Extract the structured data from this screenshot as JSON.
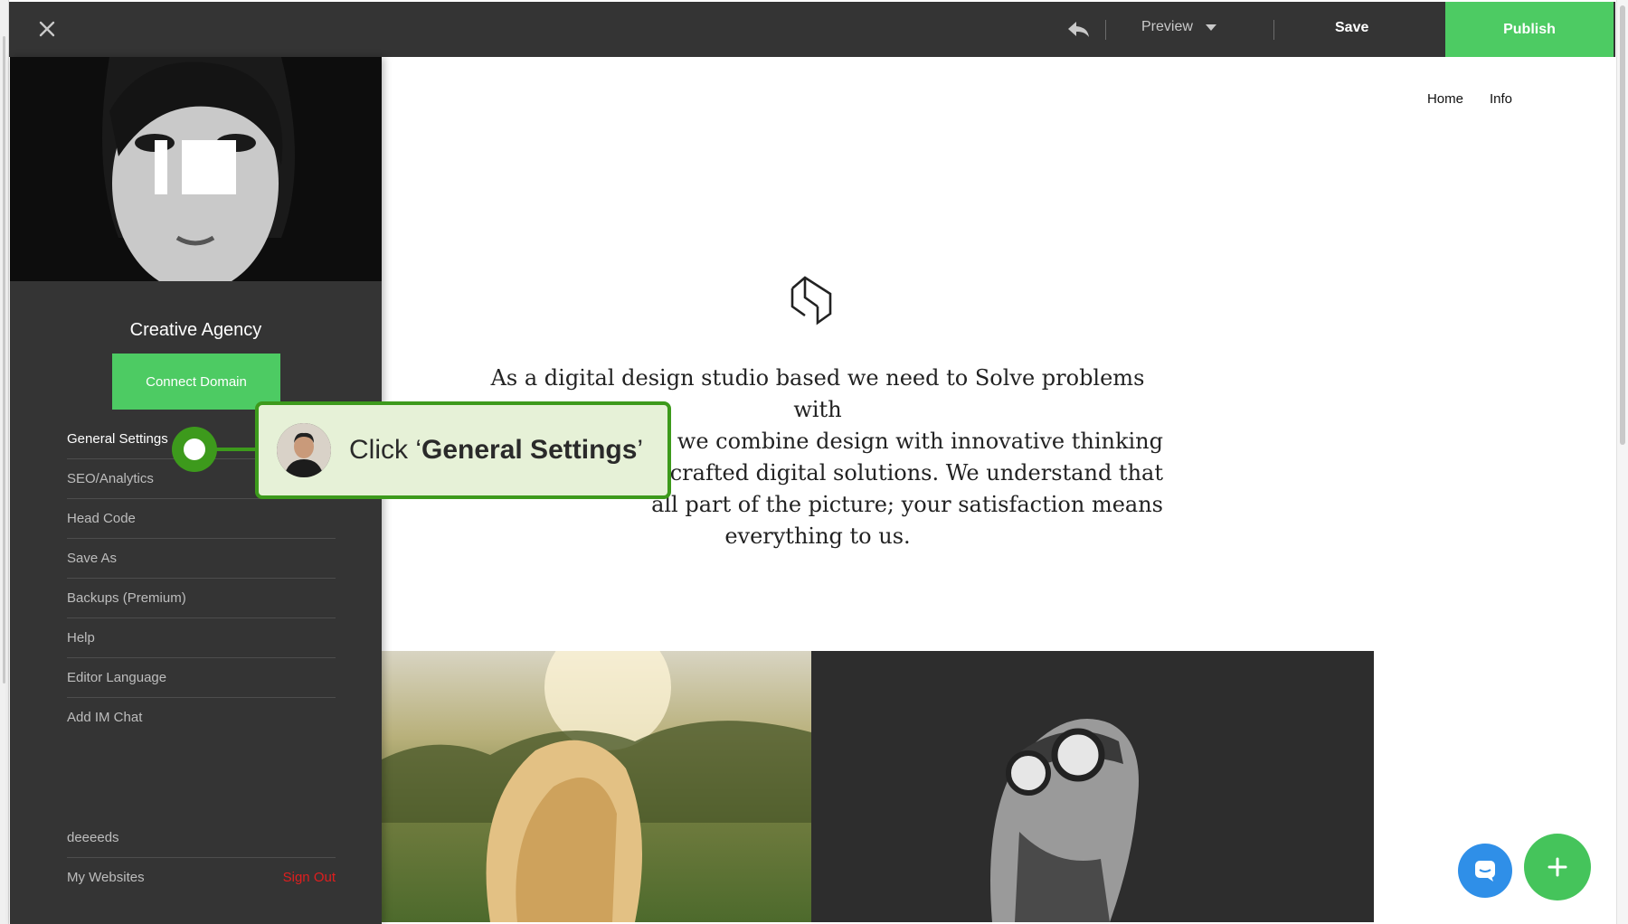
{
  "toolbar": {
    "close_icon": "close-icon",
    "undo_icon": "undo-icon",
    "preview_label": "Preview",
    "save_label": "Save",
    "publish_label": "Publish"
  },
  "site": {
    "nav": [
      "Home",
      "Info"
    ],
    "logo_icon": "brand-logo-icon",
    "about_lines": [
      "As a digital design studio based we need to Solve problems with",
      "ty, we combine design with innovative thinking",
      "ly crafted digital solutions. We understand that",
      "all part of the picture; your satisfaction means",
      "everything to us."
    ]
  },
  "panel": {
    "site_name": "Creative Agency",
    "connect_label": "Connect Domain",
    "menu": [
      "General Settings",
      "SEO/Analytics",
      "Head Code",
      "Save As",
      "Backups (Premium)",
      "Help",
      "Editor Language",
      "Add IM Chat"
    ],
    "username": "deeeeds",
    "my_websites": "My Websites",
    "sign_out": "Sign Out"
  },
  "tutorial": {
    "prefix": "Click ‘",
    "target": "General Settings",
    "suffix": "’"
  },
  "colors": {
    "dark_bg": "#343434",
    "accent_green": "#4dcb63",
    "callout_green": "#3d9a1c",
    "callout_bg": "#e6f1d7",
    "chat_blue": "#2f8fe8",
    "sign_out_red": "#e01e1e"
  }
}
